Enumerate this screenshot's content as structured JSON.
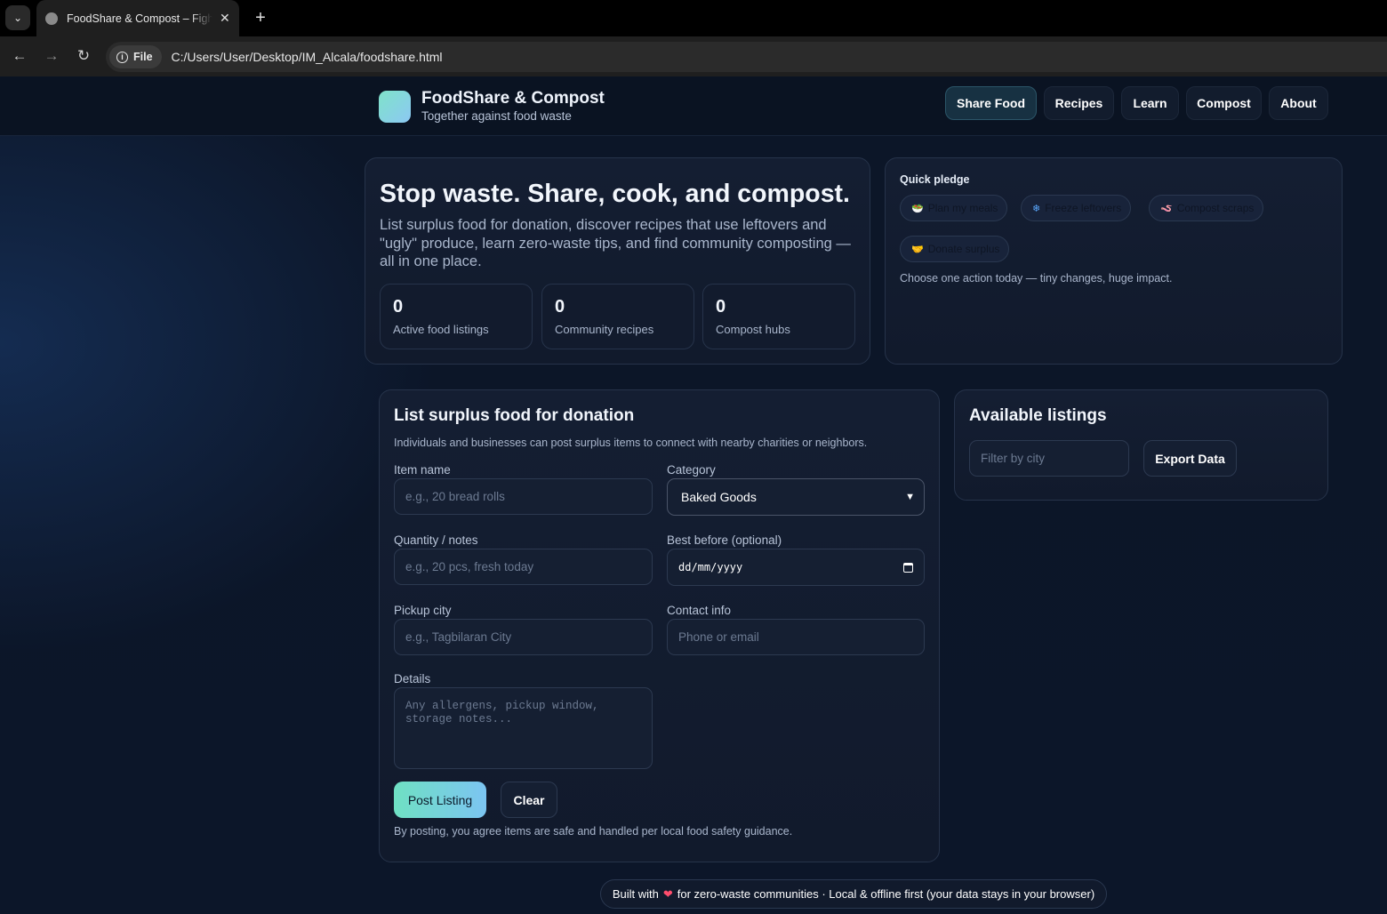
{
  "browser": {
    "tab_title": "FoodShare & Compost – Fight Food Waste",
    "url_chip": "File",
    "url": "C:/Users/User/Desktop/IM_Alcala/foodshare.html"
  },
  "header": {
    "brand_title": "FoodShare & Compost",
    "brand_sub": "Together against food waste",
    "nav": [
      {
        "label": "Share Food",
        "active": true
      },
      {
        "label": "Recipes"
      },
      {
        "label": "Learn"
      },
      {
        "label": "Compost"
      },
      {
        "label": "About"
      }
    ]
  },
  "hero": {
    "title": "Stop waste. Share, cook, and compost.",
    "text": "List surplus food for donation, discover recipes that use leftovers and \"ugly\" produce, learn zero-waste tips, and find community composting — all in one place.",
    "stats": [
      {
        "value": "0",
        "label": "Active food listings"
      },
      {
        "value": "0",
        "label": "Community recipes"
      },
      {
        "value": "0",
        "label": "Compost hubs"
      }
    ]
  },
  "pledge": {
    "title": "Quick pledge",
    "chips": [
      {
        "icon": "🥗",
        "label": "Plan my meals"
      },
      {
        "icon": "❄",
        "label": "Freeze leftovers"
      },
      {
        "icon": "🪱",
        "label": "Compost scraps"
      },
      {
        "icon": "🤝",
        "label": "Donate surplus"
      }
    ],
    "note": "Choose one action today — tiny changes, huge impact."
  },
  "form": {
    "title": "List surplus food for donation",
    "desc": "Individuals and businesses can post surplus items to connect with nearby charities or neighbors.",
    "item_label": "Item name",
    "item_placeholder": "e.g., 20 bread rolls",
    "category_label": "Category",
    "category_value": "Baked Goods",
    "qty_label": "Quantity / notes",
    "qty_placeholder": "e.g., 20 pcs, fresh today",
    "best_label": "Best before (optional)",
    "best_placeholder": "dd/mm/yyyy",
    "city_label": "Pickup city",
    "city_placeholder": "e.g., Tagbilaran City",
    "contact_label": "Contact info",
    "contact_placeholder": "Phone or email",
    "details_label": "Details",
    "details_placeholder": "Any allergens, pickup window, storage notes...",
    "post_label": "Post Listing",
    "clear_label": "Clear",
    "note": "By posting, you agree items are safe and handled per local food safety guidance."
  },
  "listings": {
    "title": "Available listings",
    "filter_placeholder": "Filter by city",
    "export_label": "Export Data"
  },
  "footer": {
    "before": "Built with",
    "after": "for zero-waste communities · Local & offline first (your data stays in your browser)"
  },
  "colors": {
    "accent_from": "#6fe0c3",
    "accent_to": "#7cc5f2",
    "page_bg": "#0c1628",
    "heart": "#ff4d6d"
  }
}
